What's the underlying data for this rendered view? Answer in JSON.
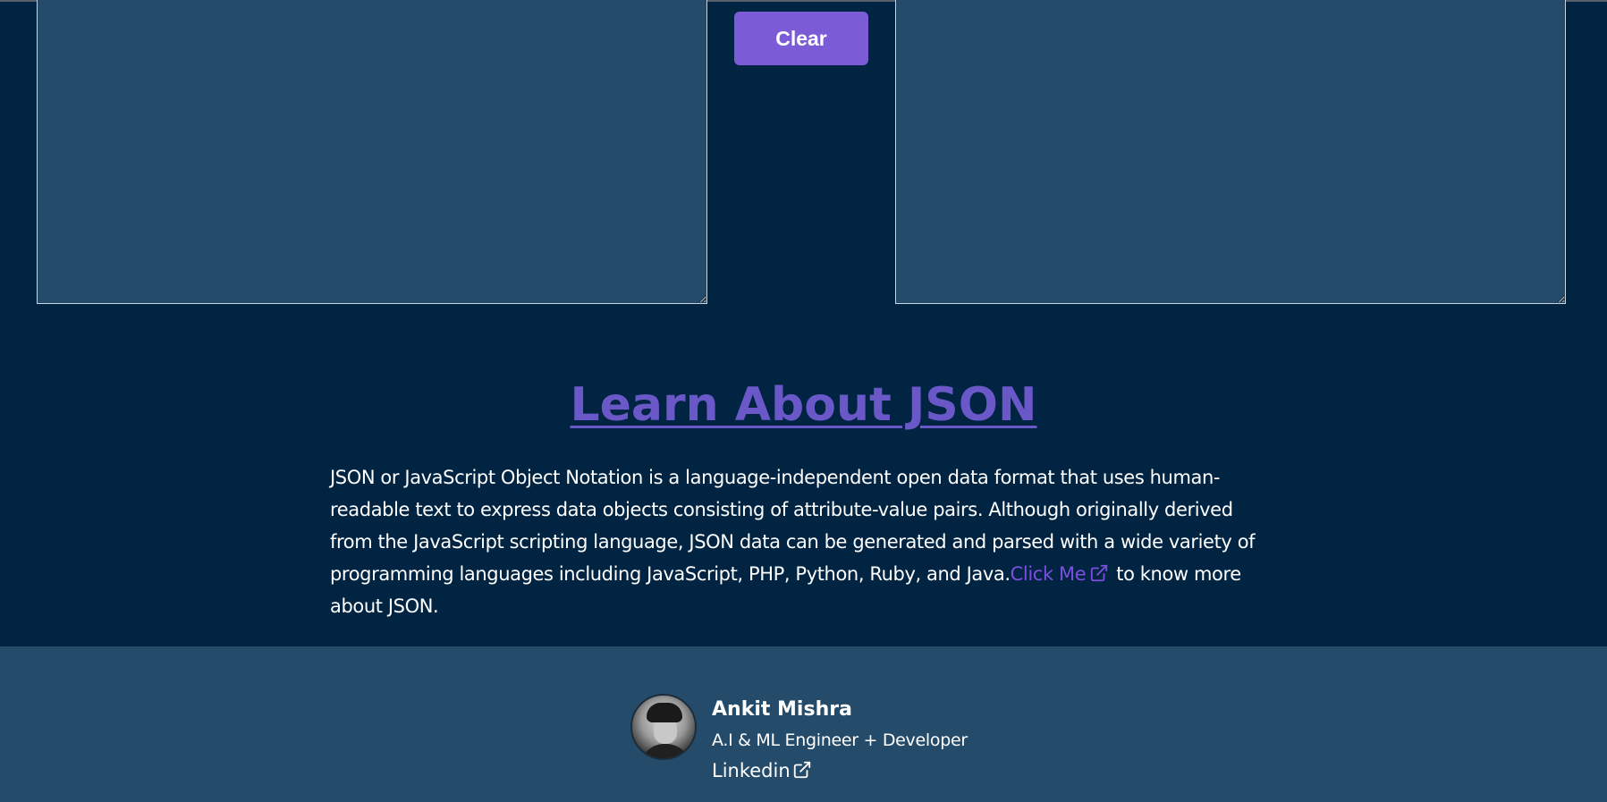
{
  "editor": {
    "input_value": "",
    "output_value": "",
    "clear_label": "Clear"
  },
  "learn": {
    "title": "Learn About JSON",
    "paragraph": "JSON or JavaScript Object Notation is a language-independent open data format that uses human-readable text to express data objects consisting of attribute-value pairs. Although originally derived from the JavaScript scripting language, JSON data can be generated and parsed with a wide variety of programming languages including JavaScript, PHP, Python, Ruby, and Java.",
    "link_label": "Click Me",
    "link_icon": "external-link-icon",
    "trailing_text": "to know more about JSON."
  },
  "footer": {
    "avatar_icon": "profile-photo",
    "name": "Ankit Mishra",
    "role": "A.I & ML Engineer + Developer",
    "link_label": "Linkedin",
    "link_icon": "external-link-icon"
  },
  "colors": {
    "background": "#012443",
    "panel": "#254b6a",
    "accent": "#7c5cd6",
    "heading": "#6a58c9",
    "link": "#7c4fe0"
  }
}
